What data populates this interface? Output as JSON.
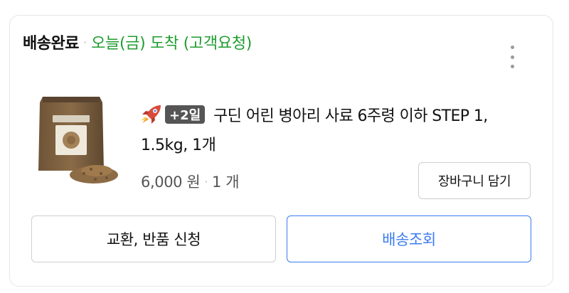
{
  "order": {
    "status": "배송완료",
    "separator": "·",
    "arrival": "오늘(금) 도착 (고객요청)"
  },
  "product": {
    "badge": "+2일",
    "name_line1": "구딘 어린 병아리 사료 6주령 이하 STEP 1,",
    "name_line2": "1.5kg, 1개",
    "price": "6,000 원",
    "price_separator": "·",
    "quantity": "1 개",
    "icons": [
      "rocket-delivery-icon",
      "more-options-icon"
    ]
  },
  "actions": {
    "add_to_cart": "장바구니 담기",
    "exchange_return": "교환, 반품 신청",
    "track_delivery": "배송조회"
  },
  "colors": {
    "arrival_green": "#1f9d2f",
    "track_blue": "#3b7cf0",
    "badge_bg": "#555555"
  }
}
